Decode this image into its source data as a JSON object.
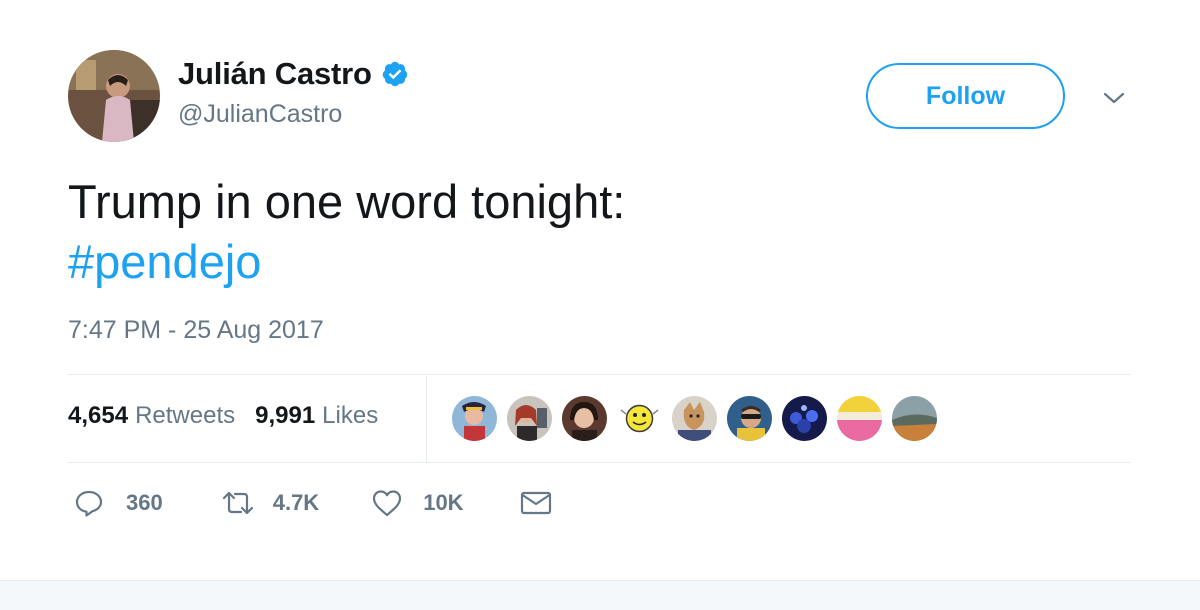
{
  "user": {
    "display_name": "Julián Castro",
    "handle": "@JulianCastro",
    "verified": true
  },
  "follow_button": {
    "label": "Follow"
  },
  "tweet": {
    "text_line1": "Trump in one word tonight:",
    "hashtag": "#pendejo",
    "timestamp": "7:47 PM - 25 Aug 2017"
  },
  "stats": {
    "retweets_count": "4,654",
    "retweets_label": "Retweets",
    "likes_count": "9,991",
    "likes_label": "Likes"
  },
  "actions": {
    "reply_count": "360",
    "retweet_count": "4.7K",
    "like_count": "10K"
  },
  "icons": [
    "verified-badge-icon",
    "chevron-down-icon",
    "reply-icon",
    "retweet-icon",
    "heart-icon",
    "envelope-icon"
  ],
  "colors": {
    "accent": "#1da1f2",
    "text": "#14171a",
    "secondary": "#657786",
    "divider": "#e6ecf0"
  }
}
